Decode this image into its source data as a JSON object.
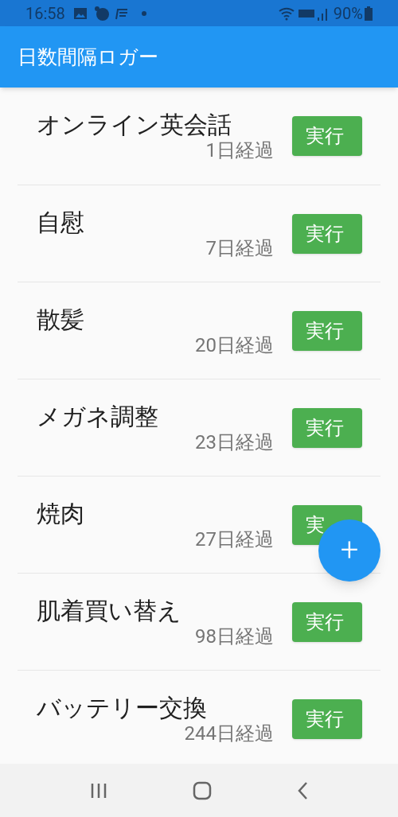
{
  "status_bar": {
    "time": "16:58",
    "battery": "90%"
  },
  "app_bar": {
    "title": "日数間隔ロガー"
  },
  "items": [
    {
      "title": "オンライン英会話",
      "elapsed": "1日経過",
      "button": "実行"
    },
    {
      "title": "自慰",
      "elapsed": "7日経過",
      "button": "実行"
    },
    {
      "title": "散髪",
      "elapsed": "20日経過",
      "button": "実行"
    },
    {
      "title": "メガネ調整",
      "elapsed": "23日経過",
      "button": "実行"
    },
    {
      "title": "焼肉",
      "elapsed": "27日経過",
      "button": "実"
    },
    {
      "title": "肌着買い替え",
      "elapsed": "98日経過",
      "button": "実行"
    },
    {
      "title": "バッテリー交換",
      "elapsed": "244日経過",
      "button": "実行"
    }
  ],
  "fab": {
    "label": "+"
  }
}
